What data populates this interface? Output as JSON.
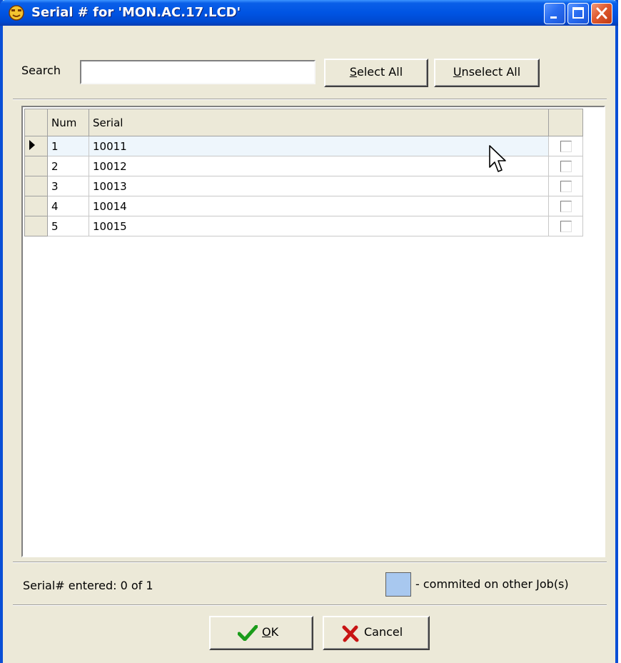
{
  "window": {
    "title": "Serial # for 'MON.AC.17.LCD'",
    "title_icon": "app-icon"
  },
  "search": {
    "label": "Search",
    "value": ""
  },
  "toolbar": {
    "select_all_prefix": "S",
    "select_all_rest": "elect All",
    "unselect_all_prefix": "U",
    "unselect_all_rest": "nselect All"
  },
  "grid": {
    "columns": [
      "Num",
      "Serial"
    ],
    "rows": [
      {
        "num": "1",
        "serial": "10011",
        "checked": false,
        "current": true
      },
      {
        "num": "2",
        "serial": "10012",
        "checked": false,
        "current": false
      },
      {
        "num": "3",
        "serial": "10013",
        "checked": false,
        "current": false
      },
      {
        "num": "4",
        "serial": "10014",
        "checked": false,
        "current": false
      },
      {
        "num": "5",
        "serial": "10015",
        "checked": false,
        "current": false
      }
    ]
  },
  "status": {
    "text": "Serial# entered: 0 of 1",
    "legend_text": "- commited on other Job(s)",
    "legend_color": "#a8c8ef"
  },
  "footer": {
    "ok_prefix": "O",
    "ok_rest": "K",
    "cancel_label": "Cancel"
  },
  "colors": {
    "titlebar": "#0054e3",
    "dialog_bg": "#ece9d8",
    "ok_check": "#1a9c1a",
    "cancel_x": "#c81414"
  }
}
